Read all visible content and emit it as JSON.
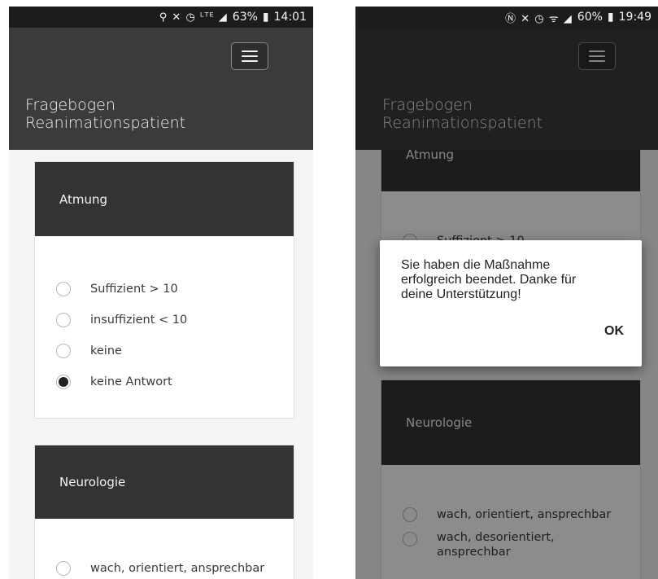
{
  "left": {
    "status": {
      "icons": "⚲ ✕ ◷ ᴸᵀᴱ ◢",
      "battery": "63%",
      "battery_icon": "battery-icon",
      "time": "14:01"
    },
    "app_title_line1": "Fragebogen",
    "app_title_line2": "Reanimationspatient",
    "cards": [
      {
        "title": "Atmung",
        "options": [
          {
            "label": "Suffizient > 10",
            "checked": false
          },
          {
            "label": "insuffizient < 10",
            "checked": false
          },
          {
            "label": "keine",
            "checked": false
          },
          {
            "label": "keine Antwort",
            "checked": true
          }
        ]
      },
      {
        "title": "Neurologie",
        "options": [
          {
            "label": "wach, orientiert, ansprechbar",
            "checked": false
          }
        ]
      }
    ]
  },
  "right": {
    "status": {
      "icons": "Ⓝ ✕ ◷ ᯤ ◢",
      "battery": "60%",
      "battery_icon": "battery-icon",
      "time": "19:49"
    },
    "app_title_line1": "Fragebogen",
    "app_title_line2": "Reanimationspatient",
    "cards": [
      {
        "title": "Atmung",
        "options": [
          {
            "label": "Suffizient > 10",
            "checked": false
          }
        ]
      },
      {
        "title": "Neurologie",
        "options": [
          {
            "label": "wach, orientiert, ansprechbar",
            "checked": false
          },
          {
            "label": "wach, desorientiert, ansprechbar",
            "checked": false
          }
        ]
      }
    ],
    "dialog": {
      "message": "Sie haben die Maßnahme erfolgreich beendet. Danke für deine Unterstützung!",
      "ok_label": "OK"
    }
  },
  "colors": {
    "appbar": "#3b3b3b",
    "card_header": "#333333",
    "statusbar": "#1c1c1c",
    "radio_checked": "#222222"
  }
}
